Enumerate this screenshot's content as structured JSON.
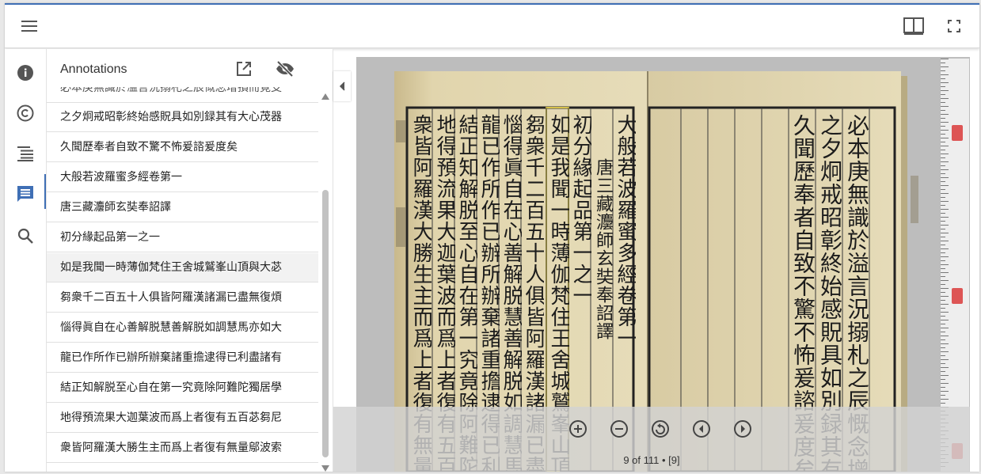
{
  "toolbar": {
    "menu_icon": "hamburger-menu-icon",
    "book_view_icon": "book-view-icon",
    "fullscreen_icon": "fullscreen-icon"
  },
  "rail": {
    "items": [
      {
        "icon": "info-icon"
      },
      {
        "icon": "copyright-icon"
      },
      {
        "icon": "table-of-contents-icon"
      },
      {
        "icon": "annotations-icon"
      },
      {
        "icon": "search-icon"
      }
    ]
  },
  "annotations_panel": {
    "title": "Annotations",
    "open_icon": "open-in-new-window-icon",
    "hide_icon": "visibility-off-icon",
    "items": [
      "必本庚無識於溢言況搦札之辰慨念增損而覓支",
      "之夕炯戒昭彰終始感貺具如別録其有大心茂器",
      "久聞歷奉者自致不驚不怖爰諮爰度矣",
      "大般若波羅蜜多經卷第一",
      "唐三藏灋師玄奘奉詔譯",
      "初分緣起品第一之一",
      "如是我聞一時薄伽梵住王舍城鷲峯山頂與大苾",
      "芻衆千二百五十人俱皆阿羅漢諸漏已盡無復煩",
      "惱得眞自在心善解脱慧善解脱如調慧馬亦如大",
      "龍已作所作已辦所辦棄諸重擔逮得已利盡諸有",
      "結正知解脱至心自在第一究竟除阿難陀獨居學",
      "地得預流果大迦葉波而爲上者復有五百苾芻尼",
      "衆皆阿羅漢大勝生主而爲上者復有無量鄔波索"
    ]
  },
  "viewer": {
    "collapse_icon": "chevron-left-icon",
    "zoom_in_icon": "zoom-in-icon",
    "zoom_out_icon": "zoom-out-icon",
    "reset_icon": "reset-zoom-icon",
    "prev_icon": "previous-page-icon",
    "next_icon": "next-page-icon",
    "page_indicator": "9 of 111 • [9]"
  },
  "colors": {
    "accent": "#3f6fb5",
    "paper": "#e2d7b3",
    "ink": "#1c1c1c"
  }
}
